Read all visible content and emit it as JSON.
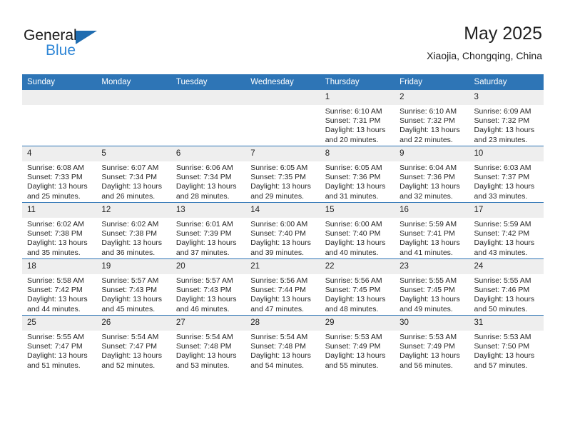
{
  "brand": {
    "name_part1": "General",
    "name_part2": "Blue",
    "accent_color": "#2e86d6",
    "triangle_color": "#1f6cb0"
  },
  "header": {
    "title": "May 2025",
    "subtitle": "Xiaojia, Chongqing, China",
    "header_bg_color": "#2e75b6"
  },
  "weekdays": [
    "Sunday",
    "Monday",
    "Tuesday",
    "Wednesday",
    "Thursday",
    "Friday",
    "Saturday"
  ],
  "weeks": [
    [
      {
        "day": "",
        "empty": true,
        "sunrise": "",
        "sunset": "",
        "daylight_line1": "",
        "daylight_line2": ""
      },
      {
        "day": "",
        "empty": true,
        "sunrise": "",
        "sunset": "",
        "daylight_line1": "",
        "daylight_line2": ""
      },
      {
        "day": "",
        "empty": true,
        "sunrise": "",
        "sunset": "",
        "daylight_line1": "",
        "daylight_line2": ""
      },
      {
        "day": "",
        "empty": true,
        "sunrise": "",
        "sunset": "",
        "daylight_line1": "",
        "daylight_line2": ""
      },
      {
        "day": "1",
        "sunrise": "Sunrise: 6:10 AM",
        "sunset": "Sunset: 7:31 PM",
        "daylight_line1": "Daylight: 13 hours",
        "daylight_line2": "and 20 minutes."
      },
      {
        "day": "2",
        "sunrise": "Sunrise: 6:10 AM",
        "sunset": "Sunset: 7:32 PM",
        "daylight_line1": "Daylight: 13 hours",
        "daylight_line2": "and 22 minutes."
      },
      {
        "day": "3",
        "sunrise": "Sunrise: 6:09 AM",
        "sunset": "Sunset: 7:32 PM",
        "daylight_line1": "Daylight: 13 hours",
        "daylight_line2": "and 23 minutes."
      }
    ],
    [
      {
        "day": "4",
        "sunrise": "Sunrise: 6:08 AM",
        "sunset": "Sunset: 7:33 PM",
        "daylight_line1": "Daylight: 13 hours",
        "daylight_line2": "and 25 minutes."
      },
      {
        "day": "5",
        "sunrise": "Sunrise: 6:07 AM",
        "sunset": "Sunset: 7:34 PM",
        "daylight_line1": "Daylight: 13 hours",
        "daylight_line2": "and 26 minutes."
      },
      {
        "day": "6",
        "sunrise": "Sunrise: 6:06 AM",
        "sunset": "Sunset: 7:34 PM",
        "daylight_line1": "Daylight: 13 hours",
        "daylight_line2": "and 28 minutes."
      },
      {
        "day": "7",
        "sunrise": "Sunrise: 6:05 AM",
        "sunset": "Sunset: 7:35 PM",
        "daylight_line1": "Daylight: 13 hours",
        "daylight_line2": "and 29 minutes."
      },
      {
        "day": "8",
        "sunrise": "Sunrise: 6:05 AM",
        "sunset": "Sunset: 7:36 PM",
        "daylight_line1": "Daylight: 13 hours",
        "daylight_line2": "and 31 minutes."
      },
      {
        "day": "9",
        "sunrise": "Sunrise: 6:04 AM",
        "sunset": "Sunset: 7:36 PM",
        "daylight_line1": "Daylight: 13 hours",
        "daylight_line2": "and 32 minutes."
      },
      {
        "day": "10",
        "sunrise": "Sunrise: 6:03 AM",
        "sunset": "Sunset: 7:37 PM",
        "daylight_line1": "Daylight: 13 hours",
        "daylight_line2": "and 33 minutes."
      }
    ],
    [
      {
        "day": "11",
        "sunrise": "Sunrise: 6:02 AM",
        "sunset": "Sunset: 7:38 PM",
        "daylight_line1": "Daylight: 13 hours",
        "daylight_line2": "and 35 minutes."
      },
      {
        "day": "12",
        "sunrise": "Sunrise: 6:02 AM",
        "sunset": "Sunset: 7:38 PM",
        "daylight_line1": "Daylight: 13 hours",
        "daylight_line2": "and 36 minutes."
      },
      {
        "day": "13",
        "sunrise": "Sunrise: 6:01 AM",
        "sunset": "Sunset: 7:39 PM",
        "daylight_line1": "Daylight: 13 hours",
        "daylight_line2": "and 37 minutes."
      },
      {
        "day": "14",
        "sunrise": "Sunrise: 6:00 AM",
        "sunset": "Sunset: 7:40 PM",
        "daylight_line1": "Daylight: 13 hours",
        "daylight_line2": "and 39 minutes."
      },
      {
        "day": "15",
        "sunrise": "Sunrise: 6:00 AM",
        "sunset": "Sunset: 7:40 PM",
        "daylight_line1": "Daylight: 13 hours",
        "daylight_line2": "and 40 minutes."
      },
      {
        "day": "16",
        "sunrise": "Sunrise: 5:59 AM",
        "sunset": "Sunset: 7:41 PM",
        "daylight_line1": "Daylight: 13 hours",
        "daylight_line2": "and 41 minutes."
      },
      {
        "day": "17",
        "sunrise": "Sunrise: 5:59 AM",
        "sunset": "Sunset: 7:42 PM",
        "daylight_line1": "Daylight: 13 hours",
        "daylight_line2": "and 43 minutes."
      }
    ],
    [
      {
        "day": "18",
        "sunrise": "Sunrise: 5:58 AM",
        "sunset": "Sunset: 7:42 PM",
        "daylight_line1": "Daylight: 13 hours",
        "daylight_line2": "and 44 minutes."
      },
      {
        "day": "19",
        "sunrise": "Sunrise: 5:57 AM",
        "sunset": "Sunset: 7:43 PM",
        "daylight_line1": "Daylight: 13 hours",
        "daylight_line2": "and 45 minutes."
      },
      {
        "day": "20",
        "sunrise": "Sunrise: 5:57 AM",
        "sunset": "Sunset: 7:43 PM",
        "daylight_line1": "Daylight: 13 hours",
        "daylight_line2": "and 46 minutes."
      },
      {
        "day": "21",
        "sunrise": "Sunrise: 5:56 AM",
        "sunset": "Sunset: 7:44 PM",
        "daylight_line1": "Daylight: 13 hours",
        "daylight_line2": "and 47 minutes."
      },
      {
        "day": "22",
        "sunrise": "Sunrise: 5:56 AM",
        "sunset": "Sunset: 7:45 PM",
        "daylight_line1": "Daylight: 13 hours",
        "daylight_line2": "and 48 minutes."
      },
      {
        "day": "23",
        "sunrise": "Sunrise: 5:55 AM",
        "sunset": "Sunset: 7:45 PM",
        "daylight_line1": "Daylight: 13 hours",
        "daylight_line2": "and 49 minutes."
      },
      {
        "day": "24",
        "sunrise": "Sunrise: 5:55 AM",
        "sunset": "Sunset: 7:46 PM",
        "daylight_line1": "Daylight: 13 hours",
        "daylight_line2": "and 50 minutes."
      }
    ],
    [
      {
        "day": "25",
        "sunrise": "Sunrise: 5:55 AM",
        "sunset": "Sunset: 7:47 PM",
        "daylight_line1": "Daylight: 13 hours",
        "daylight_line2": "and 51 minutes."
      },
      {
        "day": "26",
        "sunrise": "Sunrise: 5:54 AM",
        "sunset": "Sunset: 7:47 PM",
        "daylight_line1": "Daylight: 13 hours",
        "daylight_line2": "and 52 minutes."
      },
      {
        "day": "27",
        "sunrise": "Sunrise: 5:54 AM",
        "sunset": "Sunset: 7:48 PM",
        "daylight_line1": "Daylight: 13 hours",
        "daylight_line2": "and 53 minutes."
      },
      {
        "day": "28",
        "sunrise": "Sunrise: 5:54 AM",
        "sunset": "Sunset: 7:48 PM",
        "daylight_line1": "Daylight: 13 hours",
        "daylight_line2": "and 54 minutes."
      },
      {
        "day": "29",
        "sunrise": "Sunrise: 5:53 AM",
        "sunset": "Sunset: 7:49 PM",
        "daylight_line1": "Daylight: 13 hours",
        "daylight_line2": "and 55 minutes."
      },
      {
        "day": "30",
        "sunrise": "Sunrise: 5:53 AM",
        "sunset": "Sunset: 7:49 PM",
        "daylight_line1": "Daylight: 13 hours",
        "daylight_line2": "and 56 minutes."
      },
      {
        "day": "31",
        "sunrise": "Sunrise: 5:53 AM",
        "sunset": "Sunset: 7:50 PM",
        "daylight_line1": "Daylight: 13 hours",
        "daylight_line2": "and 57 minutes."
      }
    ]
  ]
}
